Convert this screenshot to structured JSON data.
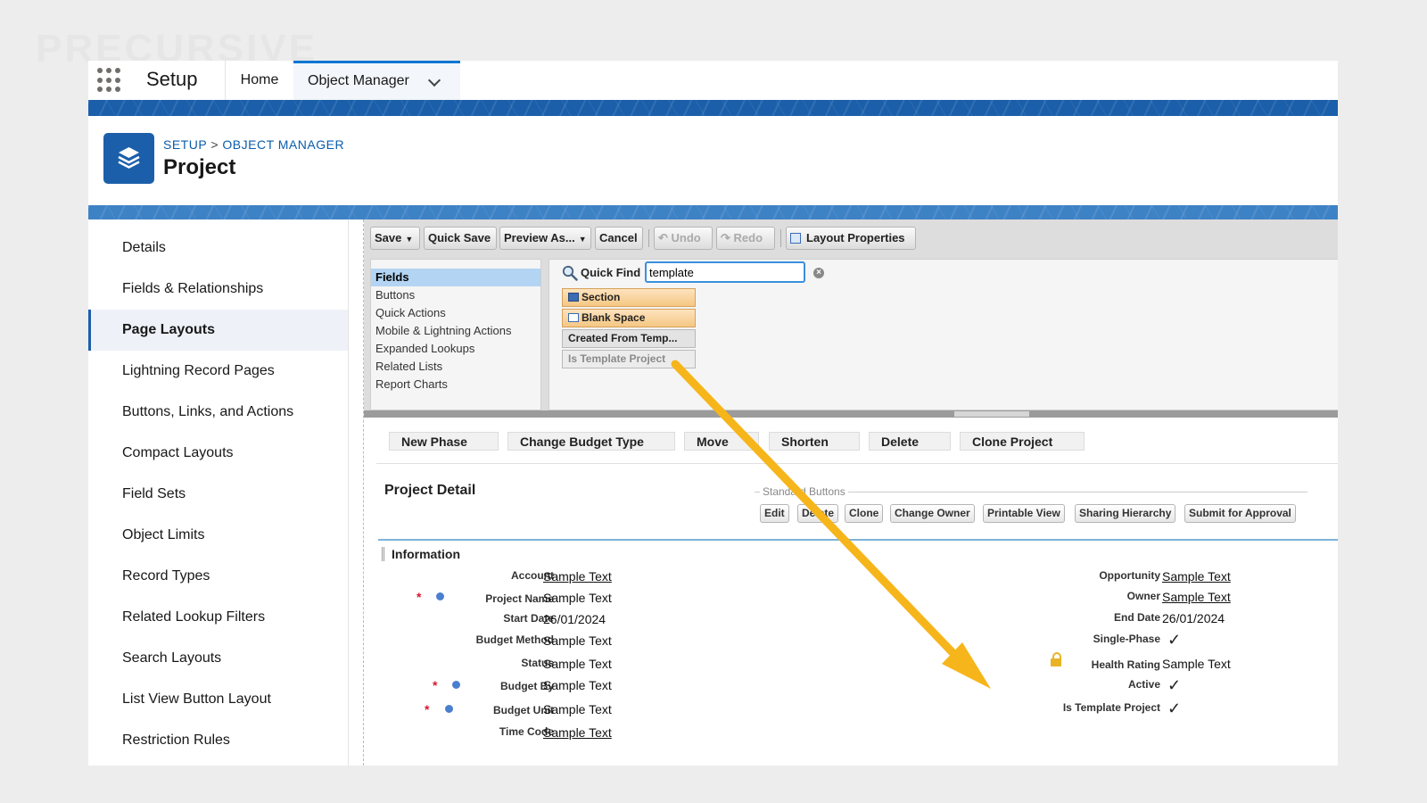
{
  "watermark": "PRECURSIVE",
  "header": {
    "app_name": "Setup",
    "tabs": [
      {
        "label": "Home"
      },
      {
        "label": "Object Manager"
      }
    ]
  },
  "object": {
    "breadcrumb": {
      "root": "SETUP",
      "separator": ">",
      "current": "OBJECT MANAGER"
    },
    "title": "Project"
  },
  "sidebar": {
    "items": [
      {
        "label": "Details"
      },
      {
        "label": "Fields & Relationships"
      },
      {
        "label": "Page Layouts",
        "active": true
      },
      {
        "label": "Lightning Record Pages"
      },
      {
        "label": "Buttons, Links, and Actions"
      },
      {
        "label": "Compact Layouts"
      },
      {
        "label": "Field Sets"
      },
      {
        "label": "Object Limits"
      },
      {
        "label": "Record Types"
      },
      {
        "label": "Related Lookup Filters"
      },
      {
        "label": "Search Layouts"
      },
      {
        "label": "List View Button Layout"
      },
      {
        "label": "Restriction Rules"
      }
    ]
  },
  "toolbar": {
    "save": "Save",
    "quick_save": "Quick Save",
    "preview_as": "Preview As...",
    "cancel": "Cancel",
    "undo": "Undo",
    "redo": "Redo",
    "layout_properties": "Layout Properties"
  },
  "palette": {
    "categories": [
      "Fields",
      "Buttons",
      "Quick Actions",
      "Mobile & Lightning Actions",
      "Expanded Lookups",
      "Related Lists",
      "Report Charts"
    ],
    "quick_find_label": "Quick Find",
    "quick_find_value": "template",
    "tiles": [
      "Section",
      "Blank Space",
      "Created From Temp...",
      "Is Template Project"
    ]
  },
  "custom_buttons": [
    "New Phase",
    "Change Budget Type",
    "Move",
    "Shorten",
    "Delete",
    "Clone Project"
  ],
  "detail": {
    "title": "Project Detail",
    "standard_buttons_label": "Standard Buttons",
    "standard_buttons": [
      "Edit",
      "Delete",
      "Clone",
      "Change Owner",
      "Printable View",
      "Sharing Hierarchy",
      "Submit for Approval"
    ],
    "section_name": "Information",
    "left_fields": [
      {
        "label": "Account",
        "value": "Sample Text"
      },
      {
        "label": "Project Name",
        "value": "Sample Text"
      },
      {
        "label": "Start Date",
        "value": "26/01/2024"
      },
      {
        "label": "Budget Method",
        "value": "Sample Text"
      },
      {
        "label": "Status",
        "value": "Sample Text"
      },
      {
        "label": "Budget By",
        "value": "Sample Text"
      },
      {
        "label": "Budget Unit",
        "value": "Sample Text"
      },
      {
        "label": "Time Code",
        "value": "Sample Text"
      }
    ],
    "right_fields": [
      {
        "label": "Opportunity",
        "value": "Sample Text"
      },
      {
        "label": "Owner",
        "value": "Sample Text"
      },
      {
        "label": "End Date",
        "value": "26/01/2024"
      },
      {
        "label": "Single-Phase",
        "value": "✓"
      },
      {
        "label": "Health Rating",
        "value": "Sample Text"
      },
      {
        "label": "Active",
        "value": "✓"
      },
      {
        "label": "Is Template Project",
        "value": "✓"
      }
    ]
  },
  "colors": {
    "brand_blue": "#1b5faa",
    "annotation_arrow": "#f6b51a",
    "required": "#d8182d"
  }
}
